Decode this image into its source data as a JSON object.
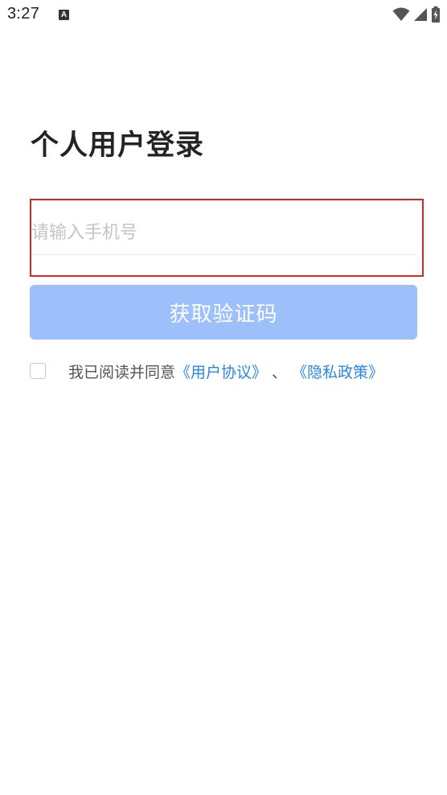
{
  "status_bar": {
    "time": "3:27",
    "notification_icon": "a-icon",
    "wifi_icon": "wifi-icon",
    "signal_icon": "signal-icon",
    "battery_icon": "battery-charging-icon"
  },
  "login": {
    "title": "个人用户登录",
    "phone_placeholder": "请输入手机号",
    "phone_value": "",
    "code_button_label": "获取验证码",
    "code_button_color": "#9dc0fb"
  },
  "agreement": {
    "checked": false,
    "prefix": "我已阅读并同意",
    "user_agreement_link": "《用户协议》",
    "separator": "、",
    "privacy_policy_link": "《隐私政策》",
    "link_color": "#2a86e6"
  }
}
